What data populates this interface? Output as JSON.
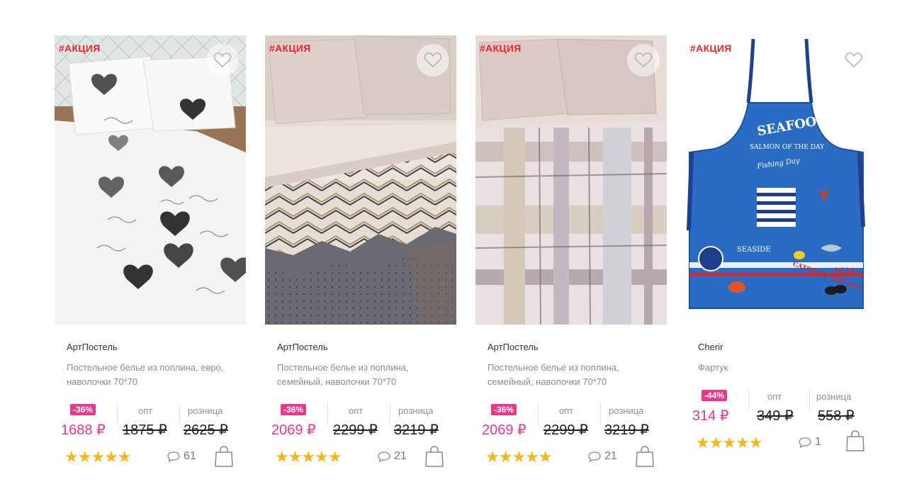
{
  "products": [
    {
      "promo": "#АКЦИЯ",
      "brand": "АртПостель",
      "title": "Постельное белье из поплина, евро, наволочки 70*70",
      "discount": "-36%",
      "price": "1688 ₽",
      "opt_label": "опт",
      "opt_price": "1875 ₽",
      "retail_label": "розница",
      "retail_price": "2625 ₽",
      "rating": "★★★★★",
      "comments": "61"
    },
    {
      "promo": "#АКЦИЯ",
      "brand": "АртПостель",
      "title": "Постельное белье из поплина, семейный, наволочки 70*70",
      "discount": "-36%",
      "price": "2069 ₽",
      "opt_label": "опт",
      "opt_price": "2299 ₽",
      "retail_label": "розница",
      "retail_price": "3219 ₽",
      "rating": "★★★★★",
      "comments": "21"
    },
    {
      "promo": "#АКЦИЯ",
      "brand": "АртПостель",
      "title": "Постельное белье из поплина, семейный, наволочки 70*70",
      "discount": "-36%",
      "price": "2069 ₽",
      "opt_label": "опт",
      "opt_price": "2299 ₽",
      "retail_label": "розница",
      "retail_price": "3219 ₽",
      "rating": "★★★★★",
      "comments": "21"
    },
    {
      "promo": "#АКЦИЯ",
      "brand": "Cherir",
      "title": "Фартук",
      "discount": "-44%",
      "price": "314 ₽",
      "opt_label": "опт",
      "opt_price": "349 ₽",
      "retail_label": "розница",
      "retail_price": "558 ₽",
      "rating": "★★★★★",
      "comments": "1",
      "apron_text": {
        "seafood": "SEAFOOD",
        "salmon": "SALMON OF THE DAY",
        "fishing": "Fishing Day",
        "seaside": "SEASIDE",
        "catch": "CATCH OF THE DAY",
        "no": "N°24"
      }
    }
  ],
  "icons": {
    "favorite": "heart-outline-icon",
    "comment": "speech-bubble-icon",
    "cart": "shopping-bag-icon"
  },
  "colors": {
    "promo": "#e8262d",
    "sale": "#e8388e",
    "star": "#f6b619"
  }
}
